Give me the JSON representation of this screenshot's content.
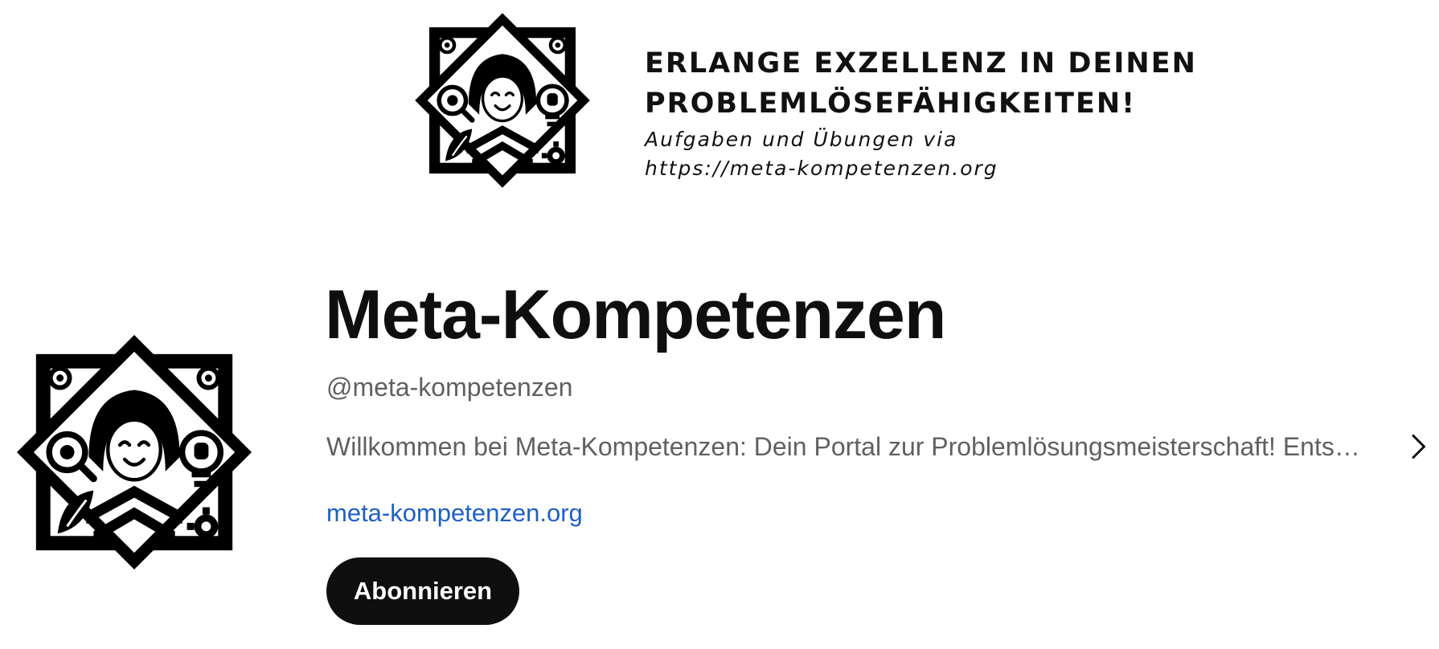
{
  "banner": {
    "headline": "ERLANGE EXZELLENZ IN DEINEN\nPROBLEMLÖSEFÄHIGKEITEN!",
    "subline": "Aufgaben und Übungen via\nhttps://meta-kompetenzen.org",
    "logo_icon": "graduate-emblem-icon"
  },
  "channel": {
    "avatar_icon": "graduate-emblem-icon",
    "title": "Meta-Kompetenzen",
    "handle": "@meta-kompetenzen",
    "description": "Willkommen bei Meta-Kompetenzen: Dein Portal zur Problemlösungsmeisterschaft! Entsc…",
    "link": "meta-kompetenzen.org",
    "subscribe_label": "Abonnieren",
    "chevron_icon": "chevron-right-icon"
  },
  "colors": {
    "link": "#1f5fc7",
    "button_bg": "#0f0f0f",
    "secondary_text": "#606060"
  }
}
